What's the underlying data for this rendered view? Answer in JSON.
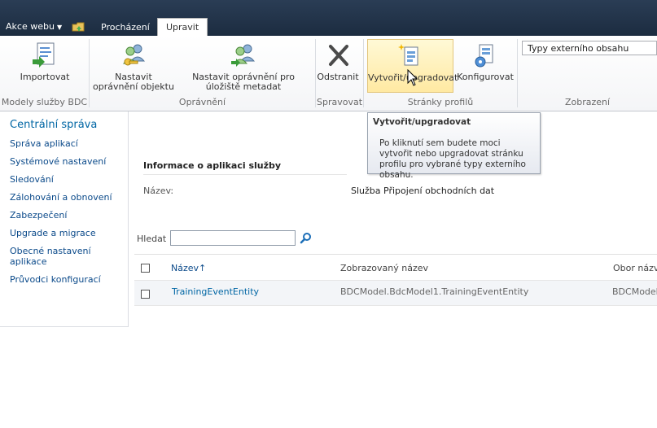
{
  "topbar": {
    "site_actions_label": "Akce webu",
    "site_actions_arrow": "▼",
    "tabs": [
      {
        "label": "Procházení",
        "active": false
      },
      {
        "label": "Upravit",
        "active": true
      }
    ]
  },
  "ribbon": {
    "buttons": {
      "import": "Importovat",
      "object_permissions": "Nastavit oprávnění objektu",
      "store_permissions": "Nastavit oprávnění pro úložiště metadat",
      "remove": "Odstranit",
      "create_upgrade": "Vytvořit/upgradovat",
      "configure": "Konfigurovat"
    },
    "groups": {
      "bdc_models": "Modely služby BDC",
      "permissions": "Oprávnění",
      "manage": "Spravovat",
      "profile_pages": "Stránky profilů",
      "view": "Zobrazení"
    },
    "view_select_value": "Typy externího obsahu"
  },
  "tooltip": {
    "title": "Vytvořit/upgradovat",
    "body": "Po kliknutí sem budete moci vytvořit nebo upgradovat stránku profilu pro vybrané typy externího obsahu."
  },
  "leftnav": {
    "heading": "Centrální správa",
    "items": [
      "Správa aplikací",
      "Systémové nastavení",
      "Sledování",
      "Zálohování a obnovení",
      "Zabezpečení",
      "Upgrade a migrace",
      "Obecné nastavení aplikace",
      "Průvodci konfigurací"
    ]
  },
  "main": {
    "section_title": "Informace o aplikaci služby",
    "name_label": "Název:",
    "name_value": "Služba Připojení obchodních dat",
    "search_label": "Hledat",
    "table": {
      "headers": [
        "Název",
        "Zobrazovaný název",
        "Obor názvů"
      ],
      "sort_indicator": "↑",
      "rows": [
        {
          "name": "TrainingEventEntity",
          "display_name": "BDCModel.BdcModel1.TrainingEventEntity",
          "namespace": "BDCModel"
        }
      ]
    }
  },
  "colors": {
    "topbar": "#1f2f44",
    "link": "#0066a4",
    "hover": "#ffe9a2"
  }
}
